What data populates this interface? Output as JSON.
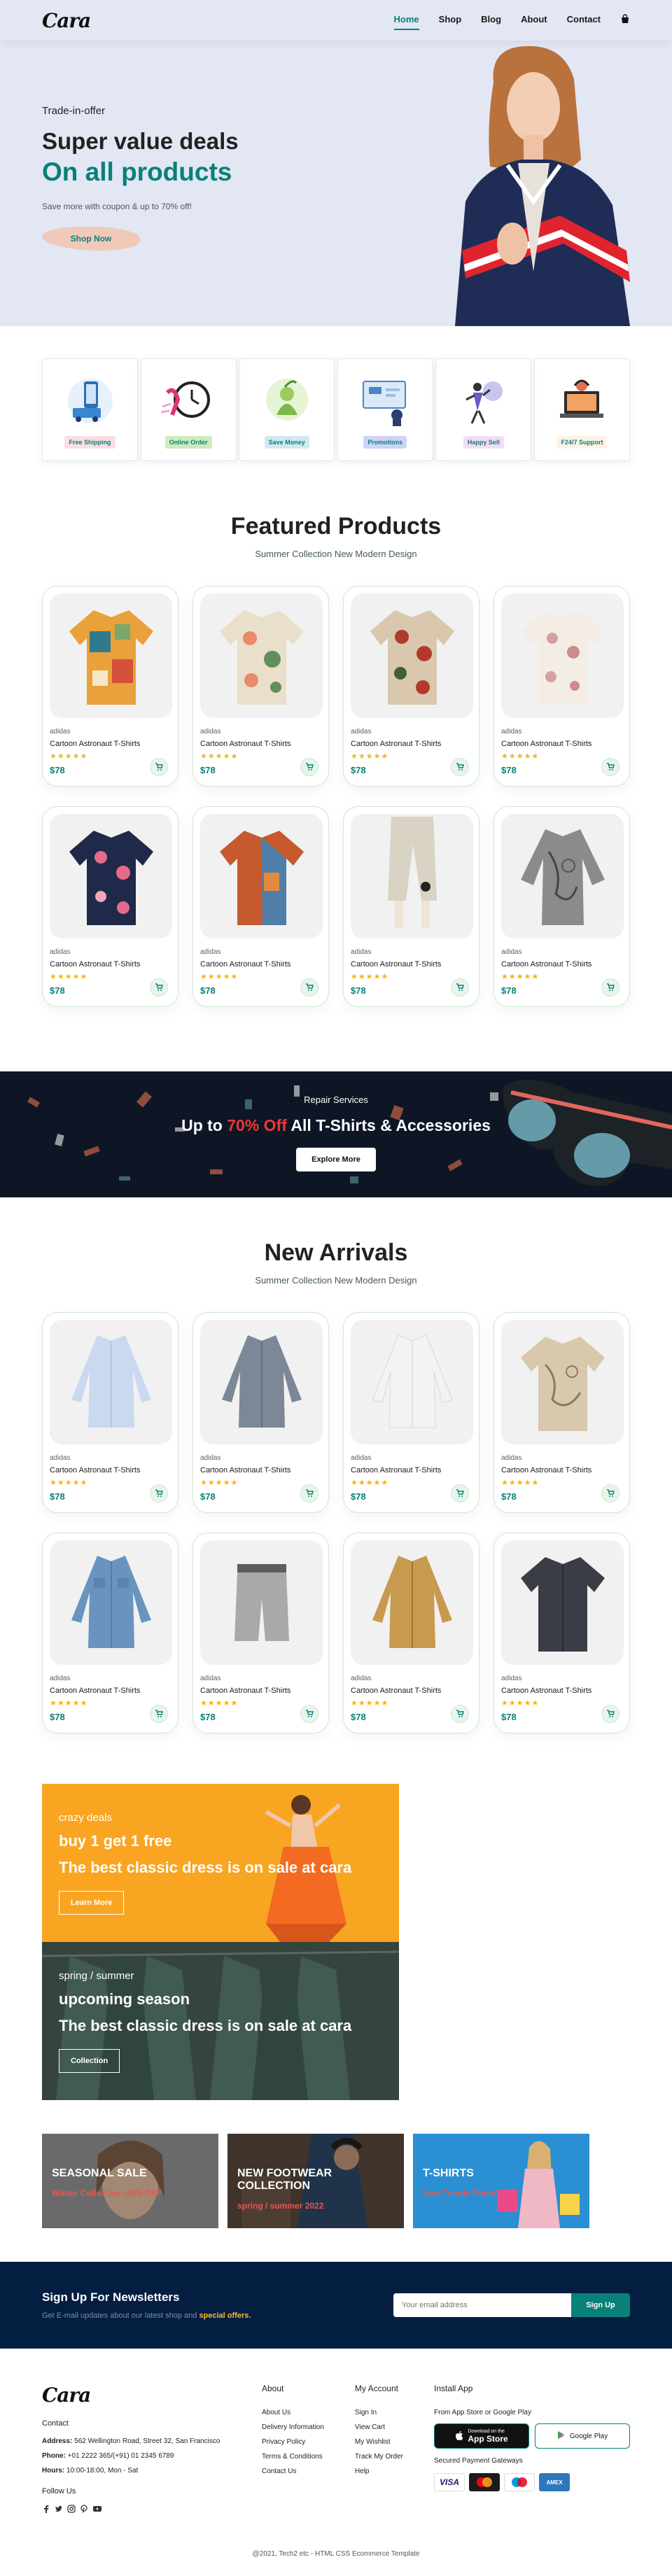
{
  "header": {
    "logo": "Cara",
    "nav": [
      "Home",
      "Shop",
      "Blog",
      "About",
      "Contact"
    ]
  },
  "hero": {
    "pre": "Trade-in-offer",
    "title": "Super value deals",
    "subtitle": "On all products",
    "desc": "Save more with coupon & up to 70% off!",
    "button": "Shop Now"
  },
  "features": [
    "Free Shipping",
    "Online Order",
    "Save Money",
    "Promotions",
    "Happy Sell",
    "F24/7 Support"
  ],
  "featured": {
    "title": "Featured Products",
    "subtitle": "Summer Collection New Modern Design",
    "products": [
      {
        "brand": "adidas",
        "name": "Cartoon Astronaut T-Shirts",
        "stars": "★★★★★",
        "price": "$78"
      },
      {
        "brand": "adidas",
        "name": "Cartoon Astronaut T-Shirts",
        "stars": "★★★★★",
        "price": "$78"
      },
      {
        "brand": "adidas",
        "name": "Cartoon Astronaut T-Shirts",
        "stars": "★★★★★",
        "price": "$78"
      },
      {
        "brand": "adidas",
        "name": "Cartoon Astronaut T-Shirts",
        "stars": "★★★★★",
        "price": "$78"
      },
      {
        "brand": "adidas",
        "name": "Cartoon Astronaut T-Shirts",
        "stars": "★★★★★",
        "price": "$78"
      },
      {
        "brand": "adidas",
        "name": "Cartoon Astronaut T-Shirts",
        "stars": "★★★★★",
        "price": "$78"
      },
      {
        "brand": "adidas",
        "name": "Cartoon Astronaut T-Shirts",
        "stars": "★★★★★",
        "price": "$78"
      },
      {
        "brand": "adidas",
        "name": "Cartoon Astronaut T-Shirts",
        "stars": "★★★★★",
        "price": "$78"
      }
    ]
  },
  "banner": {
    "pre": "Repair Services",
    "title_a": "Up to ",
    "title_b": "70% Off",
    "title_c": " All T-Shirts & Accessories",
    "button": "Explore More"
  },
  "arrivals": {
    "title": "New Arrivals",
    "subtitle": "Summer Collection New Modern Design",
    "products": [
      {
        "brand": "adidas",
        "name": "Cartoon Astronaut T-Shirts",
        "stars": "★★★★★",
        "price": "$78"
      },
      {
        "brand": "adidas",
        "name": "Cartoon Astronaut T-Shirts",
        "stars": "★★★★★",
        "price": "$78"
      },
      {
        "brand": "adidas",
        "name": "Cartoon Astronaut T-Shirts",
        "stars": "★★★★★",
        "price": "$78"
      },
      {
        "brand": "adidas",
        "name": "Cartoon Astronaut T-Shirts",
        "stars": "★★★★★",
        "price": "$78"
      },
      {
        "brand": "adidas",
        "name": "Cartoon Astronaut T-Shirts",
        "stars": "★★★★★",
        "price": "$78"
      },
      {
        "brand": "adidas",
        "name": "Cartoon Astronaut T-Shirts",
        "stars": "★★★★★",
        "price": "$78"
      },
      {
        "brand": "adidas",
        "name": "Cartoon Astronaut T-Shirts",
        "stars": "★★★★★",
        "price": "$78"
      },
      {
        "brand": "adidas",
        "name": "Cartoon Astronaut T-Shirts",
        "stars": "★★★★★",
        "price": "$78"
      }
    ]
  },
  "sm_banners": [
    {
      "pre": "crazy deals",
      "title": "buy 1 get 1 free",
      "desc": "The best classic dress is on sale at cara",
      "button": "Learn More"
    },
    {
      "pre": "spring / summer",
      "title": "upcoming season",
      "desc": "The best classic dress is on sale at cara",
      "button": "Collection"
    }
  ],
  "banner3": [
    {
      "title": "SEASONAL SALE",
      "sub": "Winter Collection -50% OFF"
    },
    {
      "title": "NEW FOOTWEAR COLLECTION",
      "sub": "spring / summer 2022"
    },
    {
      "title": "T-SHIRTS",
      "sub": "New Trendy Prints"
    }
  ],
  "newsletter": {
    "title": "Sign Up For Newsletters",
    "desc_a": "Get E-mail updates about our latest shop and ",
    "desc_b": "special offers.",
    "placeholder": "Your email address",
    "button": "Sign Up"
  },
  "footer": {
    "logo": "Cara",
    "contact_title": "Contact",
    "address_label": "Address:",
    "address": " 562 Wellington Road, Street 32, San Francisco",
    "phone_label": "Phone:",
    "phone": " +01 2222 365/(+91) 01 2345 6789",
    "hours_label": "Hours:",
    "hours": " 10:00-18:00, Mon - Sat",
    "follow": "Follow Us",
    "about_title": "About",
    "about_links": [
      "About Us",
      "Delivery Information",
      "Privacy Policy",
      "Terms & Conditions",
      "Contact Us"
    ],
    "account_title": "My Account",
    "account_links": [
      "Sign In",
      "View Cart",
      "My Wishlist",
      "Track My Order",
      "Help"
    ],
    "install_title": "Install App",
    "install_desc": "From App Store or Google Play",
    "app_store_small": "Download on the",
    "app_store": "App Store",
    "google_play": "Google Play",
    "secured": "Secured Payment Gateways",
    "copyright": "@2021, Tech2 etc - HTML CSS Ecommerce Template"
  },
  "colors": {
    "accent": "#088178",
    "hero_bg": "#e3e6f3",
    "sale_red": "#ef3636",
    "news_bg": "#041e42"
  }
}
